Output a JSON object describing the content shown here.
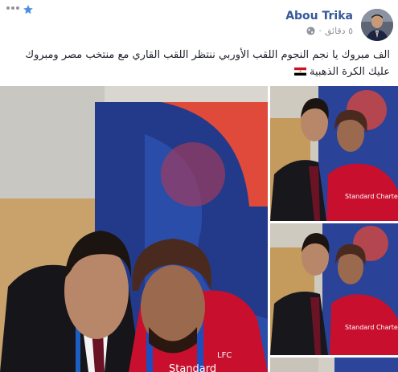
{
  "author": {
    "name": "Abou Trika"
  },
  "meta": {
    "time": "٥ دقائق",
    "privacy_icon": "globe-icon"
  },
  "post": {
    "text": "الف مبروك يا نجم النجوم اللقب الأوربي ننتظر اللقب القاري مع منتخب مصر ومبروك عليك الكرة الذهبية",
    "flag_icon": "egypt-flag-icon"
  },
  "header_icons": [
    "star-icon",
    "more-options-icon"
  ],
  "photos": [
    {
      "id": "main",
      "jersey_text": "Standard",
      "badge_text": "LFC"
    },
    {
      "id": "top",
      "jersey_text": "Standard Chartered"
    },
    {
      "id": "mid",
      "jersey_text": "Standard Chartered"
    },
    {
      "id": "bottom"
    }
  ],
  "colors": {
    "link": "#365899",
    "meta": "#90949c",
    "liverpool_red": "#c8102e",
    "star": "#4a90e2"
  }
}
